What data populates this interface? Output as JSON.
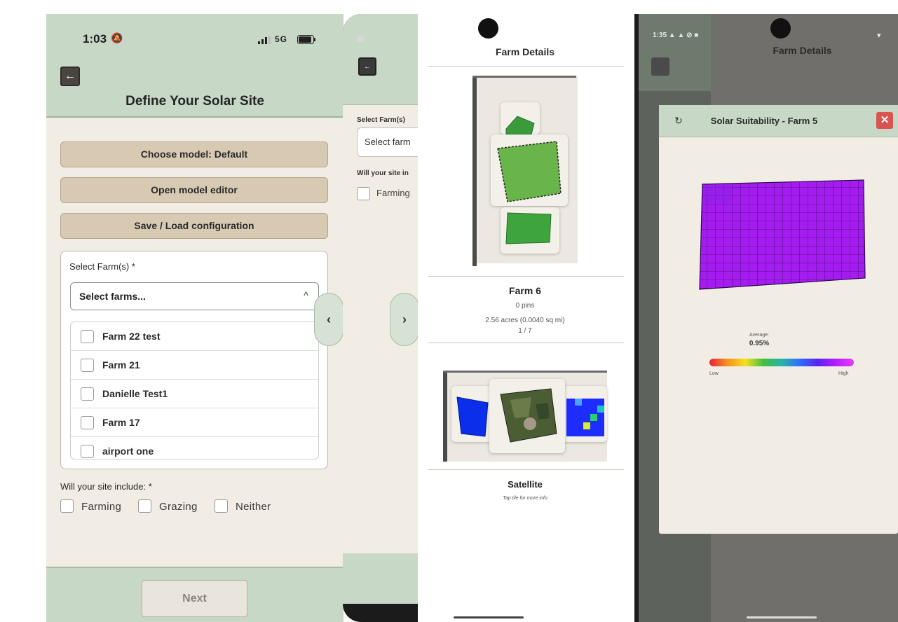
{
  "screen1": {
    "status_time": "1:03",
    "status_right": "5G",
    "back_icon": "←",
    "title": "Define Your Solar Site",
    "buttons": [
      "Choose model: Default",
      "Open model editor",
      "Save / Load configuration"
    ],
    "select_farms_label": "Select Farm(s) *",
    "select_farms_placeholder": "Select farms...",
    "farm_options": [
      "Farm 22 test",
      "Farm 21",
      "Danielle Test1",
      "Farm 17",
      "airport one"
    ],
    "include_label": "Will your site include: *",
    "include_options": [
      "Farming",
      "Grazing",
      "Neither"
    ],
    "next_label": "Next",
    "chevron_left": "‹",
    "chevron_right": "›"
  },
  "screen2": {
    "select_farms_label": "Select Farm(s)",
    "select_farms_placeholder": "Select farm",
    "include_label": "Will your site in",
    "include_option": "Farming"
  },
  "screen3": {
    "title": "Farm Details",
    "farm_name": "Farm 6",
    "pins": "0 pins",
    "area": "2.56 acres (0.0040 sq mi)",
    "index": "1 / 7",
    "layer_name": "Satellite",
    "layer_hint": "Tap tile for more info"
  },
  "screen4": {
    "status": "1:35 ▲ ▲ ⊘ ■",
    "bg_title": "Farm Details",
    "modal_title": "Solar Suitability - Farm 5",
    "average_label": "Average:",
    "average_value": "0.95%",
    "low_label": "Low",
    "high_label": "High"
  },
  "colors": {
    "header_green": "#c7d8c6",
    "background_cream": "#f1ece4",
    "tan_button": "#d8c9b3",
    "suitability_purple": "#a020ef"
  }
}
